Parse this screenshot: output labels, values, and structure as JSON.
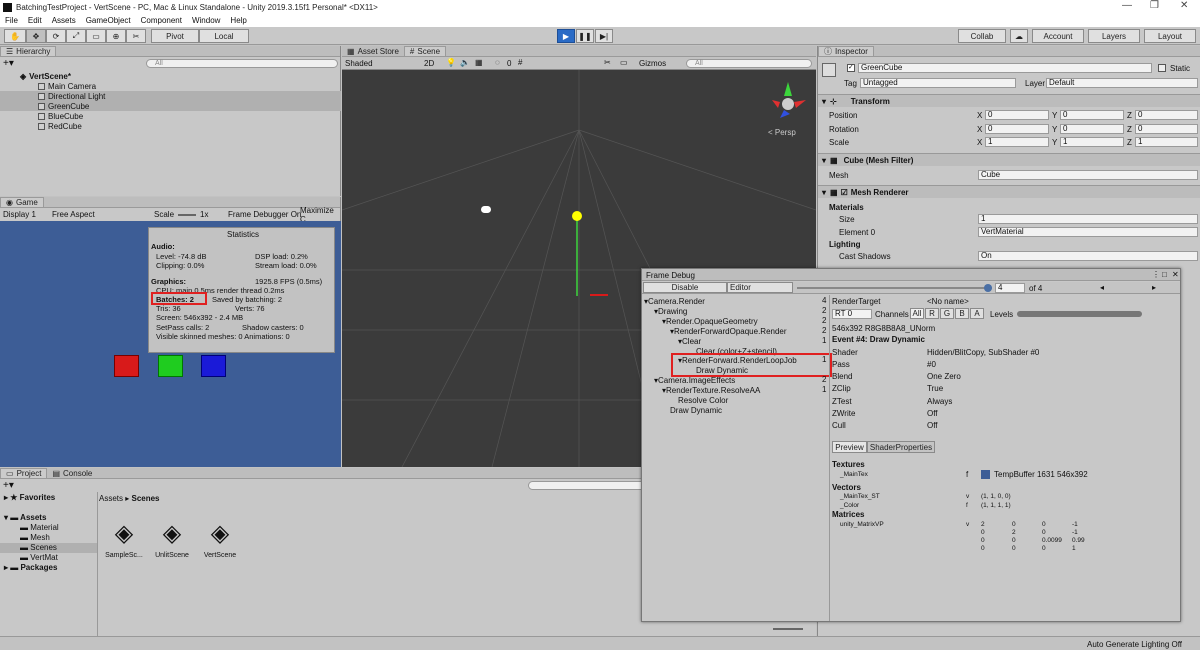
{
  "title": "BatchingTestProject - VertScene - PC, Mac & Linux Standalone - Unity 2019.3.15f1 Personal* <DX11>",
  "menu": [
    "File",
    "Edit",
    "Assets",
    "GameObject",
    "Component",
    "Window",
    "Help"
  ],
  "toolbar": {
    "pivot": "Pivot",
    "local": "Local",
    "collab": "Collab",
    "account": "Account",
    "layers": "Layers",
    "layout": "Layout"
  },
  "hierarchy": {
    "tab": "Hierarchy",
    "search_placeholder": "All",
    "scene": "VertScene*",
    "items": [
      "Main Camera",
      "Directional Light",
      "GreenCube",
      "BlueCube",
      "RedCube"
    ]
  },
  "game": {
    "tab": "Game",
    "display": "Display 1",
    "aspect": "Free Aspect",
    "scale_label": "Scale",
    "scale_value": "1x",
    "frame_debugger": "Frame Debugger On",
    "maximize": "Maximize C",
    "stats": {
      "title": "Statistics",
      "audio": "Audio:",
      "level": "Level: -74.8 dB",
      "clipping": "Clipping: 0.0%",
      "dsp": "DSP load: 0.2%",
      "stream": "Stream load: 0.0%",
      "graphics": "Graphics:",
      "fps": "1925.8 FPS (0.5ms)",
      "cpu": "CPU: main 0.5ms  render thread 0.2ms",
      "batches": "Batches: 2",
      "saved": "Saved by batching: 2",
      "tris": "Tris: 36",
      "verts": "Verts: 76",
      "screen": "Screen: 546x392 - 2.4 MB",
      "setpass": "SetPass calls: 2",
      "shadow": "Shadow casters: 0",
      "skinned": "Visible skinned meshes: 0  Animations: 0"
    }
  },
  "scene": {
    "tab_store": "Asset Store",
    "tab_scene": "Scene",
    "shading": "Shaded",
    "mode2d": "2D",
    "gizmos": "Gizmos",
    "search_placeholder": "All",
    "persp": "< Persp",
    "fx_count": "0"
  },
  "inspector": {
    "tab": "Inspector",
    "name": "GreenCube",
    "static": "Static",
    "tag_label": "Tag",
    "tag": "Untagged",
    "layer_label": "Layer",
    "layer": "Default",
    "transform": "Transform",
    "position": "Position",
    "rotation": "Rotation",
    "scale": "Scale",
    "pos": [
      "0",
      "0",
      "0"
    ],
    "rot": [
      "0",
      "0",
      "0"
    ],
    "scl": [
      "1",
      "1",
      "1"
    ],
    "meshfilter": "Cube (Mesh Filter)",
    "mesh_label": "Mesh",
    "mesh": "Cube",
    "meshrenderer": "Mesh Renderer",
    "materials": "Materials",
    "size_label": "Size",
    "size": "1",
    "element_label": "Element 0",
    "element": "VertMaterial",
    "lighting": "Lighting",
    "cast_label": "Cast Shadows",
    "cast": "On"
  },
  "frame_debug": {
    "title": "Frame Debug",
    "disable": "Disable",
    "editor": "Editor",
    "step": "4",
    "of": "of 4",
    "tree": [
      {
        "label": "Camera.Render",
        "count": "4"
      },
      {
        "label": "Drawing",
        "count": "2"
      },
      {
        "label": "Render.OpaqueGeometry",
        "count": "2"
      },
      {
        "label": "RenderForwardOpaque.Render",
        "count": "2"
      },
      {
        "label": "Clear",
        "count": "1"
      },
      {
        "label": "Clear (color+Z+stencil)",
        "count": ""
      },
      {
        "label": "RenderForward.RenderLoopJob",
        "count": "1"
      },
      {
        "label": "Draw Dynamic",
        "count": ""
      },
      {
        "label": "Camera.ImageEffects",
        "count": "2"
      },
      {
        "label": "RenderTexture.ResolveAA",
        "count": "1"
      },
      {
        "label": "Resolve Color",
        "count": ""
      },
      {
        "label": "Draw Dynamic",
        "count": ""
      }
    ],
    "render_target_label": "RenderTarget",
    "render_target": "<No name>",
    "rt": "RT 0",
    "channels": "Channels",
    "ch": [
      "All",
      "R",
      "G",
      "B",
      "A"
    ],
    "levels": "Levels",
    "format": "546x392 R8G8B8A8_UNorm",
    "event": "Event #4: Draw Dynamic",
    "props": [
      {
        "k": "Shader",
        "v": "Hidden/BlitCopy, SubShader #0"
      },
      {
        "k": "Pass",
        "v": "#0"
      },
      {
        "k": "Blend",
        "v": "One Zero"
      },
      {
        "k": "ZClip",
        "v": "True"
      },
      {
        "k": "ZTest",
        "v": "Always"
      },
      {
        "k": "ZWrite",
        "v": "Off"
      },
      {
        "k": "Cull",
        "v": "Off"
      }
    ],
    "tab_preview": "Preview",
    "tab_shaderprops": "ShaderProperties",
    "textures": "Textures",
    "maintex": "_MainTex",
    "maintex_stage": "f",
    "maintex_value": "TempBuffer 1631 546x392",
    "vectors": "Vectors",
    "vec": [
      {
        "k": "_MainTex_ST",
        "s": "v",
        "v": "(1, 1, 0, 0)"
      },
      {
        "k": "_Color",
        "s": "f",
        "v": "(1, 1, 1, 1)"
      }
    ],
    "matrices": "Matrices",
    "matrix_name": "unity_MatrixVP",
    "matrix_stage": "v",
    "matrix": [
      [
        "2",
        "0",
        "0",
        "-1"
      ],
      [
        "0",
        "2",
        "0",
        "-1"
      ],
      [
        "0",
        "0",
        "0.0099",
        "0.99"
      ],
      [
        "0",
        "0",
        "0",
        "1"
      ]
    ]
  },
  "project": {
    "tab_project": "Project",
    "tab_console": "Console",
    "favorites": "Favorites",
    "assets": "Assets",
    "folders": [
      "Material",
      "Mesh",
      "Scenes",
      "VertMat"
    ],
    "packages": "Packages",
    "breadcrumb_root": "Assets",
    "breadcrumb_leaf": "Scenes",
    "files": [
      "SampleSc...",
      "UnlitScene",
      "VertScene"
    ]
  },
  "status": "Auto Generate Lighting Off",
  "colors": {
    "red": "#e02020",
    "play_blue": "#2a6bc6",
    "game_bg": "#3d5d96",
    "scene_bg": "#3b3b3b",
    "cube_red": "#d81a1a",
    "cube_green": "#1fcc1f",
    "cube_blue": "#1a1ad8"
  }
}
